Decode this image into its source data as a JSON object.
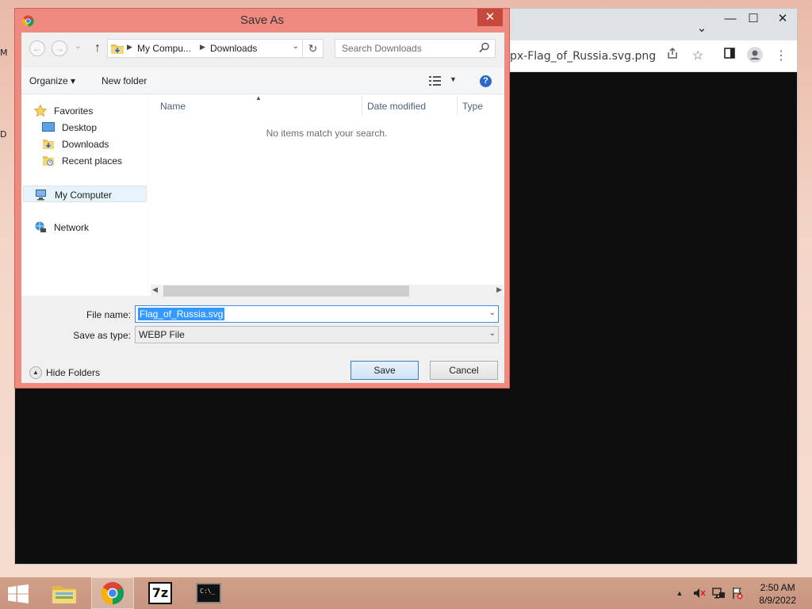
{
  "desktop": {
    "labels": [
      "M",
      "D"
    ]
  },
  "browser": {
    "address_text": "px-Flag_of_Russia.svg.png",
    "window_controls": {
      "minimize": "—",
      "maximize": "☐",
      "close": "✕"
    },
    "tab_dropdown": "⌄",
    "toolbar_icons": [
      "share-icon",
      "star-icon",
      "sidepanel-icon",
      "profile-icon",
      "menu-icon"
    ]
  },
  "dialog": {
    "title": "Save As",
    "close_glyph": "✕",
    "nav": {
      "back": "←",
      "forward": "→",
      "recent": "⌄",
      "up": "↑"
    },
    "breadcrumb": [
      "My Compu...",
      "Downloads"
    ],
    "search_placeholder": "Search Downloads",
    "organize_label": "Organize ▾",
    "new_folder_label": "New folder",
    "help_glyph": "?",
    "nav_pane": {
      "favorites": "Favorites",
      "desktop": "Desktop",
      "downloads": "Downloads",
      "recent_places": "Recent places",
      "my_computer": "My Computer",
      "network": "Network"
    },
    "columns": [
      "Name",
      "Date modified",
      "Type"
    ],
    "empty_message": "No items match your search.",
    "file_name_label": "File name:",
    "file_name_value": "Flag_of_Russia.svg",
    "save_as_type_label": "Save as type:",
    "save_as_type_value": "WEBP File",
    "hide_folders_label": "Hide Folders",
    "save_label": "Save",
    "cancel_label": "Cancel"
  },
  "taskbar": {
    "apps": [
      "file-explorer",
      "chrome",
      "7-zip",
      "command-prompt"
    ],
    "seven_zip_label": "7z",
    "cmd_label": "C:\\_",
    "tray_up": "▲",
    "time": "2:50 AM",
    "date": "8/9/2022"
  },
  "colors": {
    "dialog_frame": "#ef8a80",
    "close_button": "#c7483c",
    "selection": "#3399ff",
    "taskbar": "#c89580"
  }
}
